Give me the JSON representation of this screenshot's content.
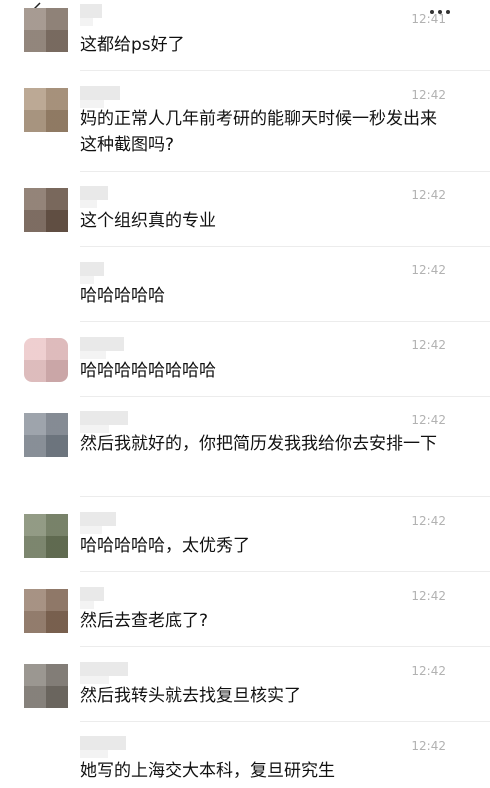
{
  "messages": [
    {
      "time": "12:41",
      "text": "这都给ps好了",
      "avatar_color": "#8a7a6e"
    },
    {
      "time": "12:42",
      "text": "妈的正常人几年前考研的能聊天时候一秒发出来这种截图吗?",
      "avatar_color": "#a58c72"
    },
    {
      "time": "12:42",
      "text": "这个组织真的专业",
      "avatar_color": "#6f5a4c"
    },
    {
      "time": "12:42",
      "text": "哈哈哈哈哈",
      "avatar_color": ""
    },
    {
      "time": "12:42",
      "text": "哈哈哈哈哈哈哈哈",
      "avatar_color": "#e9bfc0"
    },
    {
      "time": "12:42",
      "text": "然后我就好的，你把简历发我我给你去安排一下",
      "avatar_color": "#7d8590"
    },
    {
      "time": "12:42",
      "text": "哈哈哈哈哈，太优秀了",
      "avatar_color": "#6e7a5c"
    },
    {
      "time": "12:42",
      "text": "然后去查老底了?",
      "avatar_color": "#8a6e5a"
    },
    {
      "time": "12:42",
      "text": "然后我转头就去找复旦核实了",
      "avatar_color": "#7a746c"
    },
    {
      "time": "12:42",
      "text": "她写的上海交大本科，复旦研究生",
      "avatar_color": ""
    }
  ]
}
